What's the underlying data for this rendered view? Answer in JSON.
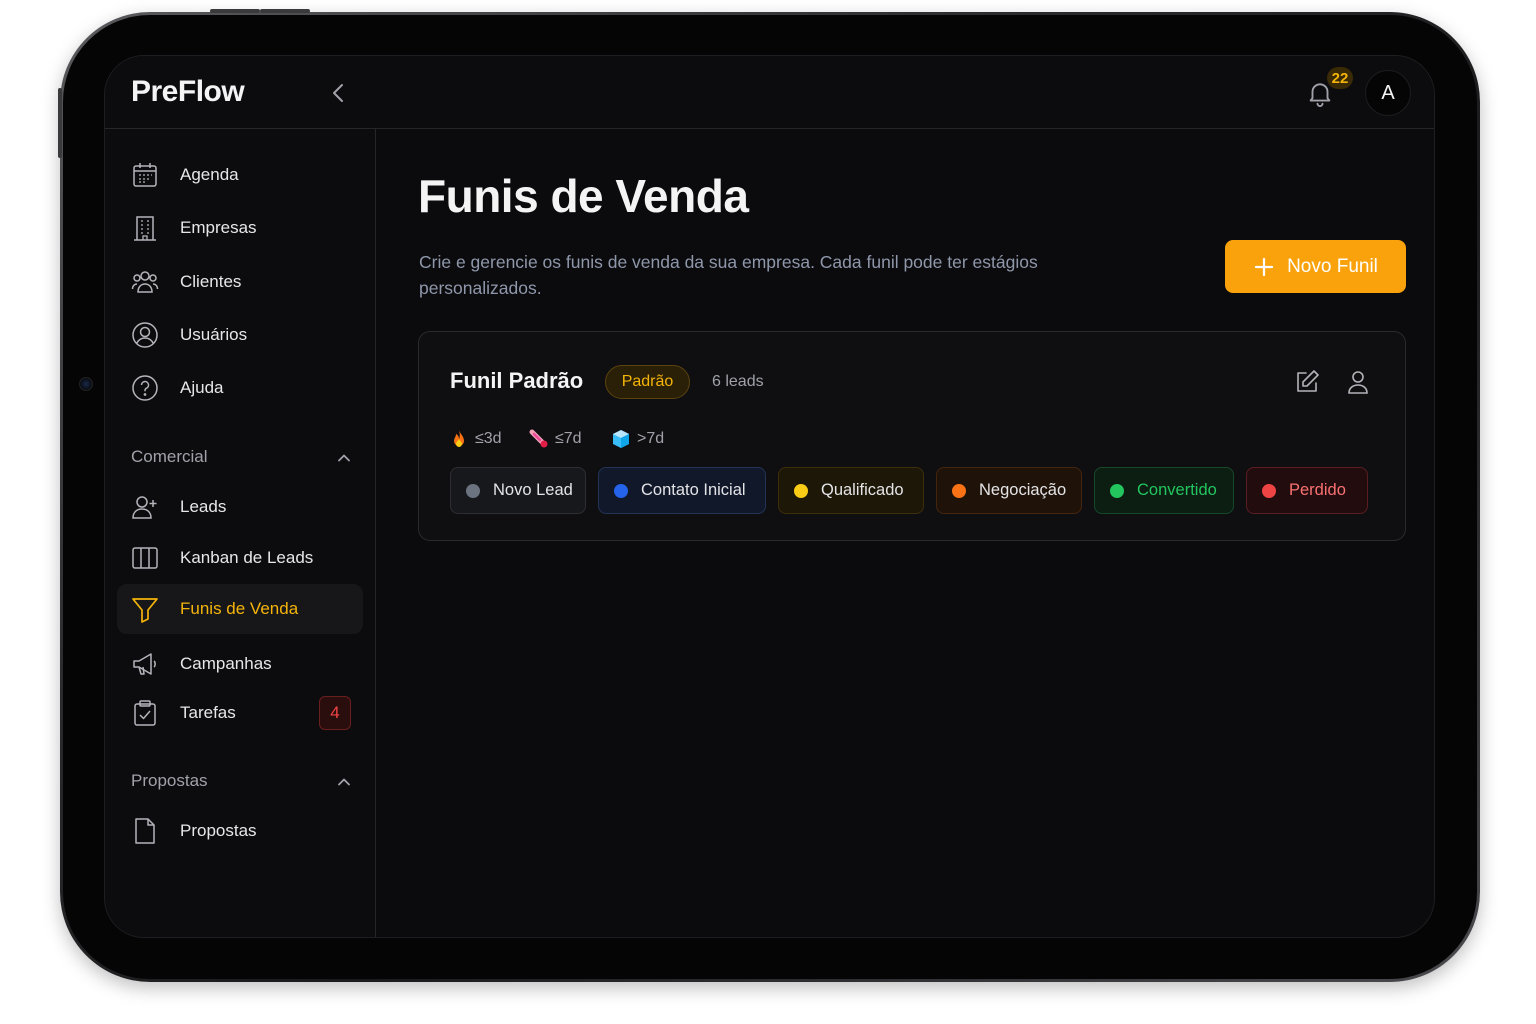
{
  "app": {
    "name": "PreFlow"
  },
  "header": {
    "notifications_count": "22",
    "avatar_initial": "A"
  },
  "sidebar": {
    "items": [
      {
        "label": "Agenda",
        "icon": "calendar-icon"
      },
      {
        "label": "Empresas",
        "icon": "building-icon"
      },
      {
        "label": "Clientes",
        "icon": "users-icon"
      },
      {
        "label": "Usuários",
        "icon": "user-circle-icon"
      },
      {
        "label": "Ajuda",
        "icon": "help-circle-icon"
      }
    ],
    "sections": [
      {
        "title": "Comercial",
        "items": [
          {
            "label": "Leads",
            "icon": "user-plus-icon"
          },
          {
            "label": "Kanban de Leads",
            "icon": "columns-icon"
          },
          {
            "label": "Funis de Venda",
            "icon": "funnel-icon",
            "active": true
          },
          {
            "label": "Campanhas",
            "icon": "megaphone-icon"
          },
          {
            "label": "Tarefas",
            "icon": "clipboard-check-icon",
            "count": "4"
          }
        ]
      },
      {
        "title": "Propostas",
        "items": [
          {
            "label": "Propostas",
            "icon": "file-icon"
          }
        ]
      }
    ]
  },
  "main": {
    "title": "Funis de Venda",
    "description": "Crie e gerencie os funis de venda da sua empresa. Cada funil pode ter estágios personalizados.",
    "new_button_label": "Novo Funil",
    "funnel": {
      "name": "Funil Padrão",
      "badge": "Padrão",
      "leads": "6 leads",
      "age_legend": [
        {
          "label": "≤3d",
          "icon": "fire-icon"
        },
        {
          "label": "≤7d",
          "icon": "thermometer-icon"
        },
        {
          "label": ">7d",
          "icon": "ice-cube-icon"
        }
      ],
      "stages": [
        {
          "label": "Novo Lead",
          "color": "#6b7280"
        },
        {
          "label": "Contato Inicial",
          "color": "#2563eb"
        },
        {
          "label": "Qualificado",
          "color": "#facc15"
        },
        {
          "label": "Negociação",
          "color": "#f97316"
        },
        {
          "label": "Convertido",
          "color": "#22c55e"
        },
        {
          "label": "Perdido",
          "color": "#ef4444"
        }
      ]
    }
  },
  "colors": {
    "accent": "#f9a20b",
    "background": "#0b0b0d"
  }
}
